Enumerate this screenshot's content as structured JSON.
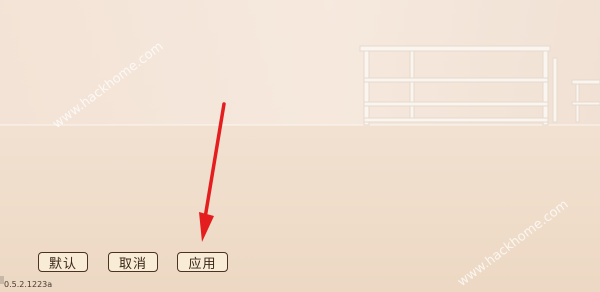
{
  "buttons": {
    "default_label": "默认",
    "cancel_label": "取消",
    "apply_label": "应用"
  },
  "version": "0.5.2.1223a",
  "watermarks": [
    "www.hackhome.com",
    "www.hackhome.com"
  ],
  "colors": {
    "arrow": "#e41e1e",
    "button_border": "#4a3322",
    "button_bg": "#f9ecd6"
  }
}
